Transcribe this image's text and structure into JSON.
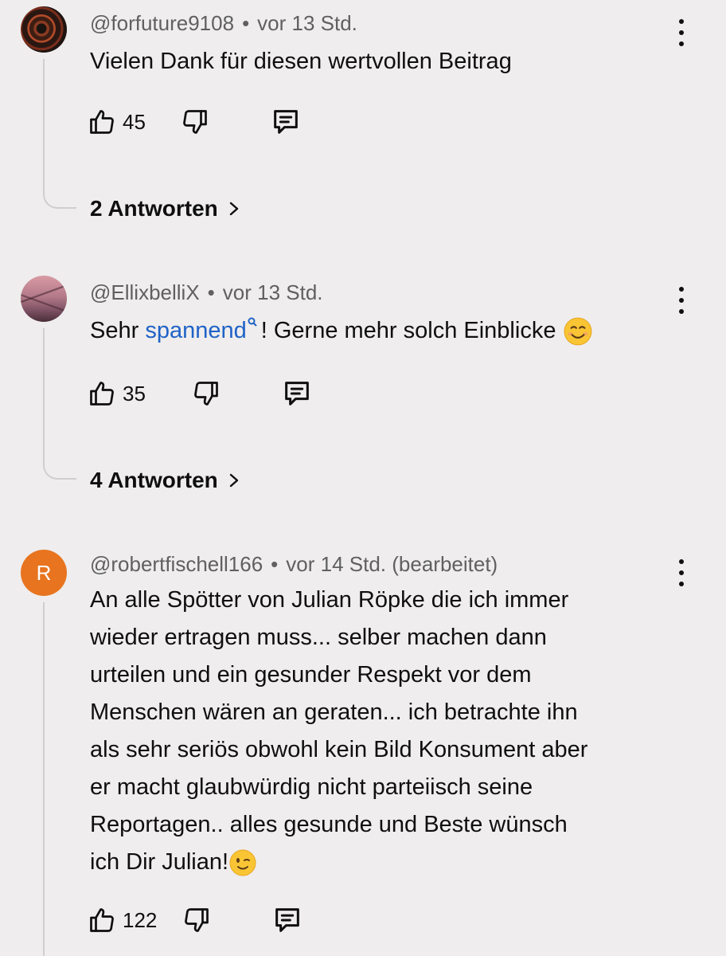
{
  "comments": [
    {
      "handle": "@forfuture9108",
      "time": "vor 13 Std.",
      "text": "Vielen Dank für diesen wertvollen Beitrag",
      "likes": "45",
      "replies_label": "2 Antworten"
    },
    {
      "handle": "@EllixbelliX",
      "time": "vor 13 Std.",
      "text_before": "Sehr ",
      "link_text": "spannend",
      "text_after": "! Gerne mehr solch Einblicke",
      "emoji": "smiling-face-emoji",
      "likes": "35",
      "replies_label": "4 Antworten"
    },
    {
      "handle": "@robertfischell166",
      "time": "vor 14 Std.",
      "edited": "(bearbeitet)",
      "avatar_letter": "R",
      "avatar_color": "#e8741f",
      "lines": [
        "An alle Spötter von Julian Röpke die ich immer",
        "wieder ertragen muss... selber machen dann",
        "urteilen und ein gesunder Respekt vor dem",
        "Menschen wären an geraten... ich betrachte ihn",
        "als sehr seriös obwohl kein Bild Konsument aber",
        "er macht glaubwürdig nicht parteiisch seine",
        "Reportagen.. alles gesunde und Beste wünsch",
        "ich Dir Julian!"
      ],
      "emoji": "winking-face-emoji",
      "likes": "122"
    }
  ],
  "separator": "•",
  "colors": {
    "background": "#efeded",
    "text": "#0f0f0f",
    "meta": "#606060",
    "link": "#1f62c7"
  }
}
